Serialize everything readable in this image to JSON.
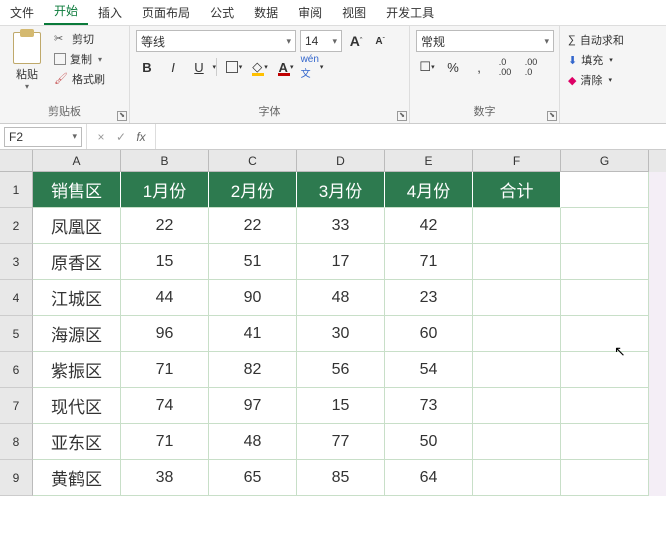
{
  "tabs": [
    "文件",
    "开始",
    "插入",
    "页面布局",
    "公式",
    "数据",
    "审阅",
    "视图",
    "开发工具"
  ],
  "activeTab": 1,
  "ribbon": {
    "clipboard": {
      "paste": "粘贴",
      "cut": "剪切",
      "copy": "复制",
      "format_painter": "格式刷",
      "group": "剪贴板"
    },
    "font": {
      "name": "等线",
      "size": "14",
      "group": "字体"
    },
    "number": {
      "format": "常规",
      "group": "数字"
    },
    "editing": {
      "autosum": "自动求和",
      "fill": "填充",
      "clear": "清除"
    }
  },
  "formula_bar": {
    "name_box": "F2",
    "value": ""
  },
  "columns": [
    "A",
    "B",
    "C",
    "D",
    "E",
    "F",
    "G"
  ],
  "header_row": [
    "销售区",
    "1月份",
    "2月份",
    "3月份",
    "4月份",
    "合计"
  ],
  "data_rows": [
    [
      "凤凰区",
      "22",
      "22",
      "33",
      "42",
      ""
    ],
    [
      "原香区",
      "15",
      "51",
      "17",
      "71",
      ""
    ],
    [
      "江城区",
      "44",
      "90",
      "48",
      "23",
      ""
    ],
    [
      "海源区",
      "96",
      "41",
      "30",
      "60",
      ""
    ],
    [
      "紫振区",
      "71",
      "82",
      "56",
      "54",
      ""
    ],
    [
      "现代区",
      "74",
      "97",
      "15",
      "73",
      ""
    ],
    [
      "亚东区",
      "71",
      "48",
      "77",
      "50",
      ""
    ],
    [
      "黄鹤区",
      "38",
      "65",
      "85",
      "64",
      ""
    ]
  ]
}
